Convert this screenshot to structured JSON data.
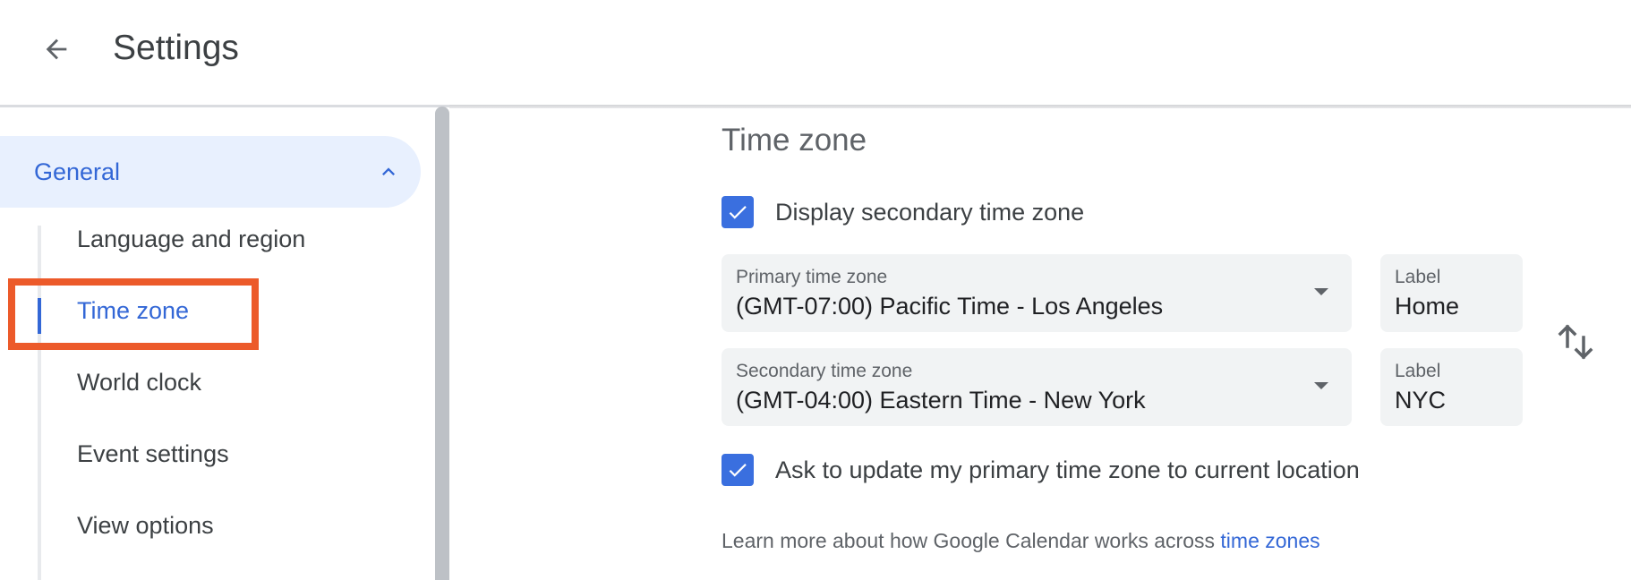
{
  "header": {
    "back_icon": "arrow-back-icon",
    "title": "Settings"
  },
  "sidebar": {
    "section": {
      "label": "General",
      "expanded": true,
      "chevron_icon": "chevron-up-icon"
    },
    "items": [
      {
        "label": "Language and region",
        "active": false
      },
      {
        "label": "Time zone",
        "active": true
      },
      {
        "label": "World clock",
        "active": false
      },
      {
        "label": "Event settings",
        "active": false
      },
      {
        "label": "View options",
        "active": false
      }
    ]
  },
  "main": {
    "section_title": "Time zone",
    "display_secondary": {
      "label": "Display secondary time zone",
      "checked": true
    },
    "primary": {
      "caption": "Primary time zone",
      "value": "(GMT-07:00) Pacific Time - Los Angeles",
      "label_caption": "Label",
      "label_value": "Home"
    },
    "secondary": {
      "caption": "Secondary time zone",
      "value": "(GMT-04:00) Eastern Time - New York",
      "label_caption": "Label",
      "label_value": "NYC"
    },
    "swap_icon": "swap-vert-icon",
    "ask_update": {
      "label": "Ask to update my primary time zone to current location",
      "checked": true
    },
    "learn_more": {
      "text": "Learn more about how Google Calendar works across ",
      "link": "time zones"
    }
  },
  "colors": {
    "accent": "#3367d6",
    "checkbox": "#3a6fdf",
    "nav_active_bg": "#e8f0fe",
    "field_bg": "#f1f3f4",
    "highlight_annotation": "#ec5a2a"
  }
}
